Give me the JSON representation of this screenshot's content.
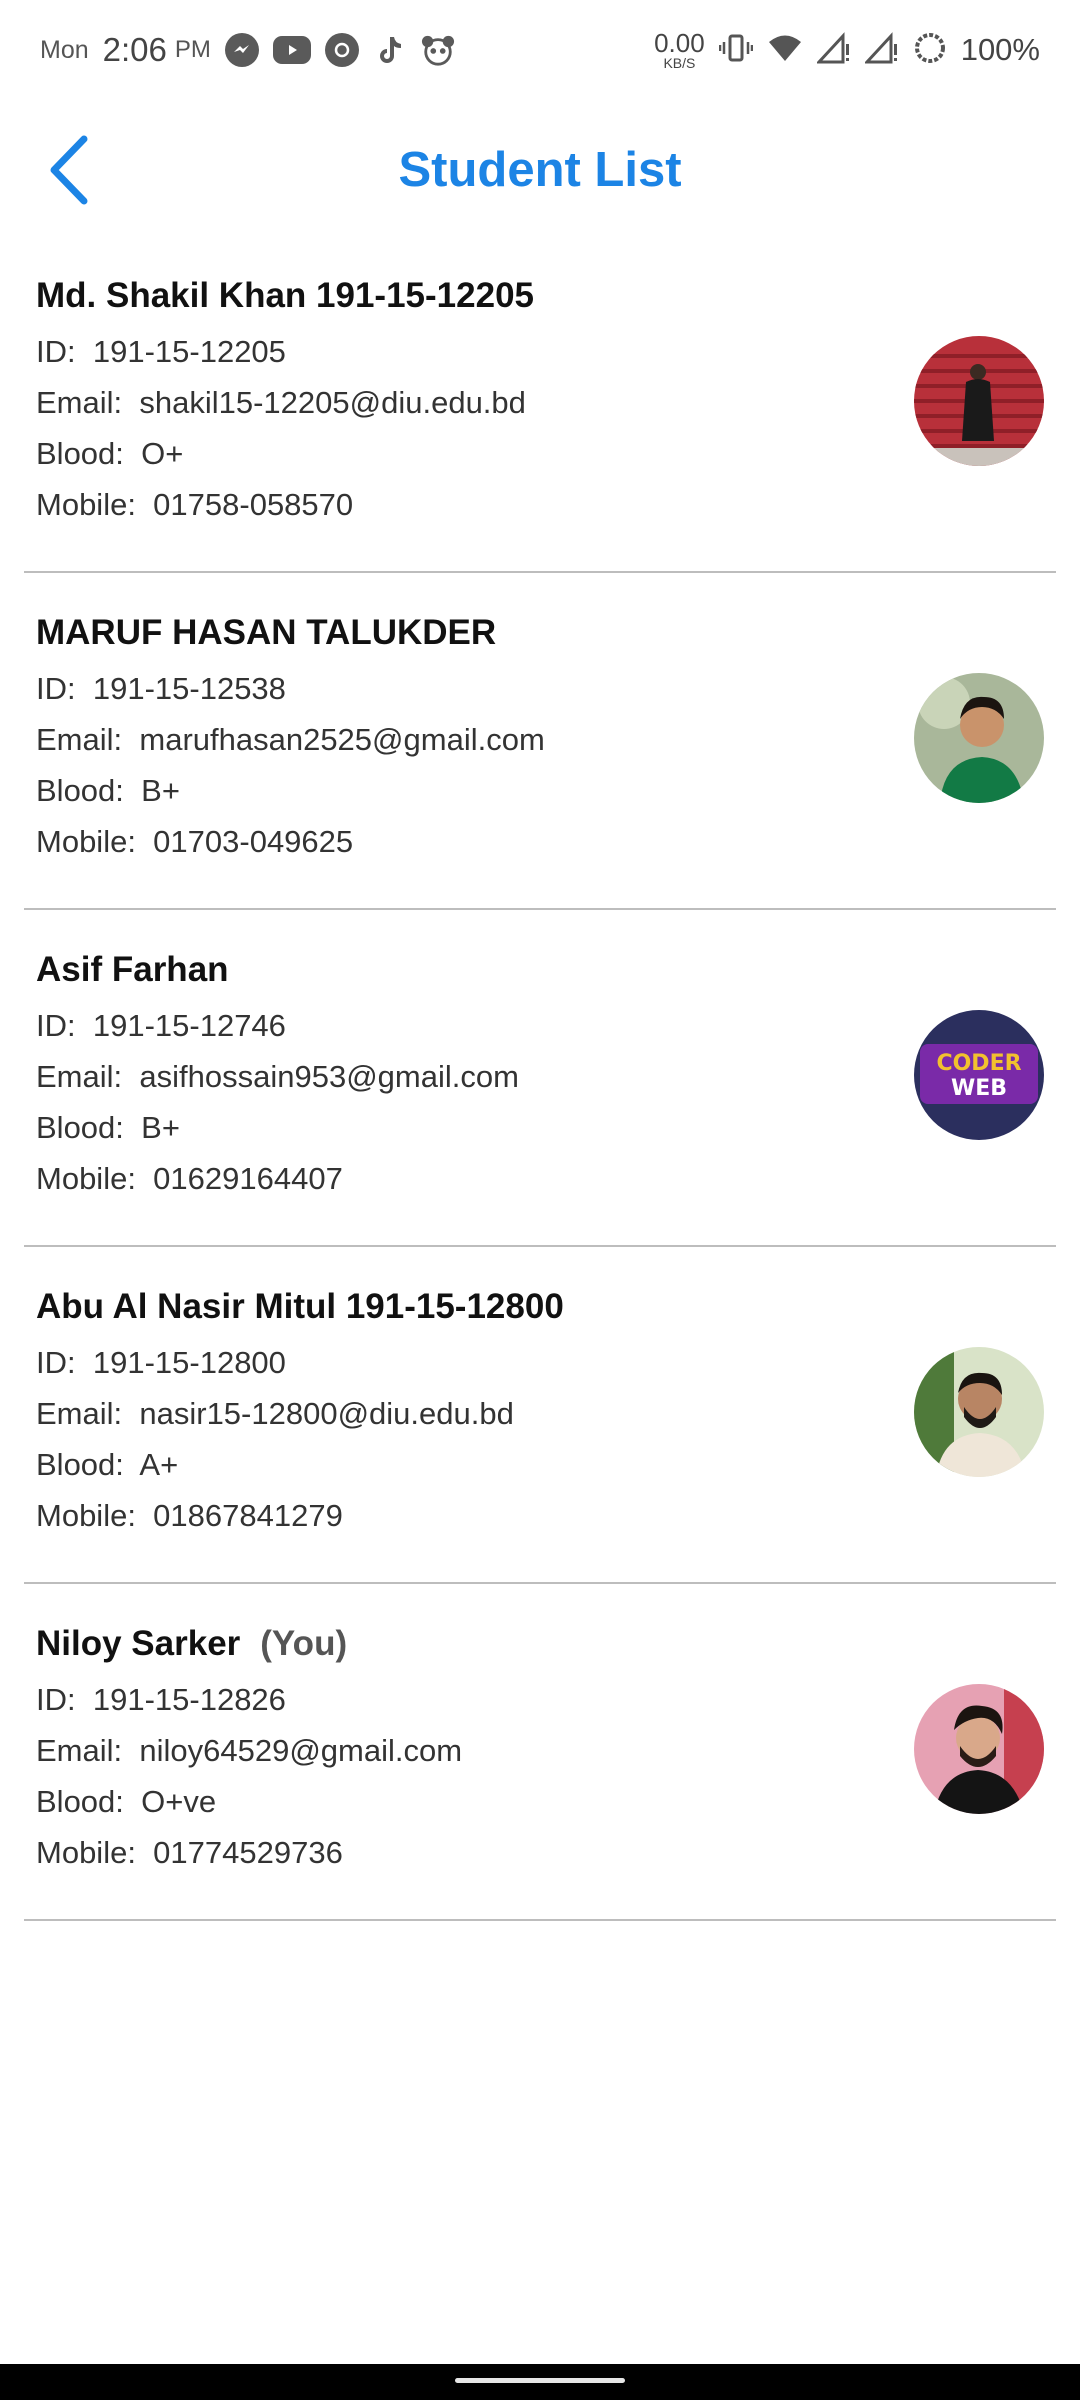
{
  "status_bar": {
    "day": "Mon",
    "time": "2:06",
    "ampm": "PM",
    "speed_value": "0.00",
    "speed_unit": "KB/S",
    "battery": "100%",
    "icons": [
      "messenger-icon",
      "youtube-icon",
      "instagram-like-icon",
      "tiktok-icon",
      "panda-icon",
      "vibrate-icon",
      "wifi-icon",
      "signal-icon",
      "signal-icon-2",
      "battery-icon"
    ]
  },
  "header": {
    "title": "Student List",
    "back_icon": "chevron-left-icon",
    "accent_color": "#1c84e5"
  },
  "labels": {
    "id": "ID:",
    "email": "Email:",
    "blood": "Blood:",
    "mobile": "Mobile:"
  },
  "students": [
    {
      "name": "Md. Shakil Khan 191-15-12205",
      "id": "191-15-12205",
      "email": "shakil15-12205@diu.edu.bd",
      "blood": "O+",
      "mobile": "01758-058570",
      "you": ""
    },
    {
      "name": "MARUF HASAN TALUKDER",
      "id": "191-15-12538",
      "email": "marufhasan2525@gmail.com",
      "blood": "B+",
      "mobile": "01703-049625",
      "you": ""
    },
    {
      "name": "Asif Farhan",
      "id": "191-15-12746",
      "email": "asifhossain953@gmail.com",
      "blood": "B+",
      "mobile": "01629164407",
      "you": "",
      "avatar_text": [
        "CODER",
        "WEB"
      ]
    },
    {
      "name": "Abu Al Nasir Mitul 191-15-12800",
      "id": "191-15-12800",
      "email": "nasir15-12800@diu.edu.bd",
      "blood": "A+",
      "mobile": "01867841279",
      "you": ""
    },
    {
      "name": "Niloy Sarker",
      "id": "191-15-12826",
      "email": "niloy64529@gmail.com",
      "blood": "O+ve",
      "mobile": "01774529736",
      "you": "(You)"
    }
  ]
}
